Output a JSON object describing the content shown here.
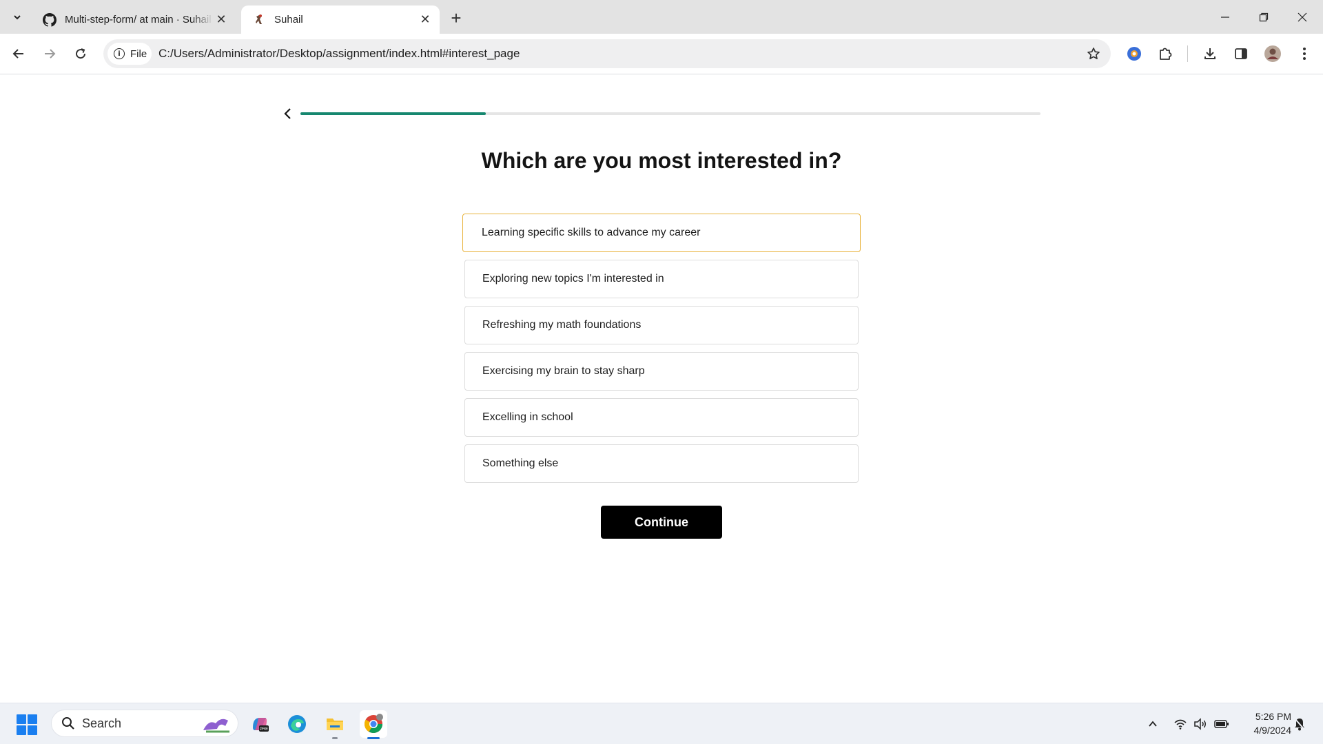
{
  "browser": {
    "tabs": [
      {
        "title": "Multi-step-form/ at main · Suhail",
        "icon": "github-icon",
        "active": false
      },
      {
        "title": "Suhail",
        "icon": "site-favicon",
        "active": true
      }
    ],
    "new_tab_label": "+",
    "site_chip_label": "File",
    "url": "C:/Users/Administrator/Desktop/assignment/index.html#interest_page"
  },
  "page": {
    "progress": 0.25,
    "progress_color": "#16876f",
    "question": "Which are you most interested in?",
    "options": [
      {
        "label": "Learning specific skills to advance my career",
        "selected": true
      },
      {
        "label": "Exploring new topics I'm interested in",
        "selected": false
      },
      {
        "label": "Refreshing my math foundations",
        "selected": false
      },
      {
        "label": "Exercising my brain to stay sharp",
        "selected": false
      },
      {
        "label": "Excelling in school",
        "selected": false
      },
      {
        "label": "Something else",
        "selected": false
      }
    ],
    "selected_border_color": "#e8b23a",
    "continue_label": "Continue"
  },
  "taskbar": {
    "search_placeholder": "Search",
    "time": "5:26 PM",
    "date": "4/9/2024"
  }
}
